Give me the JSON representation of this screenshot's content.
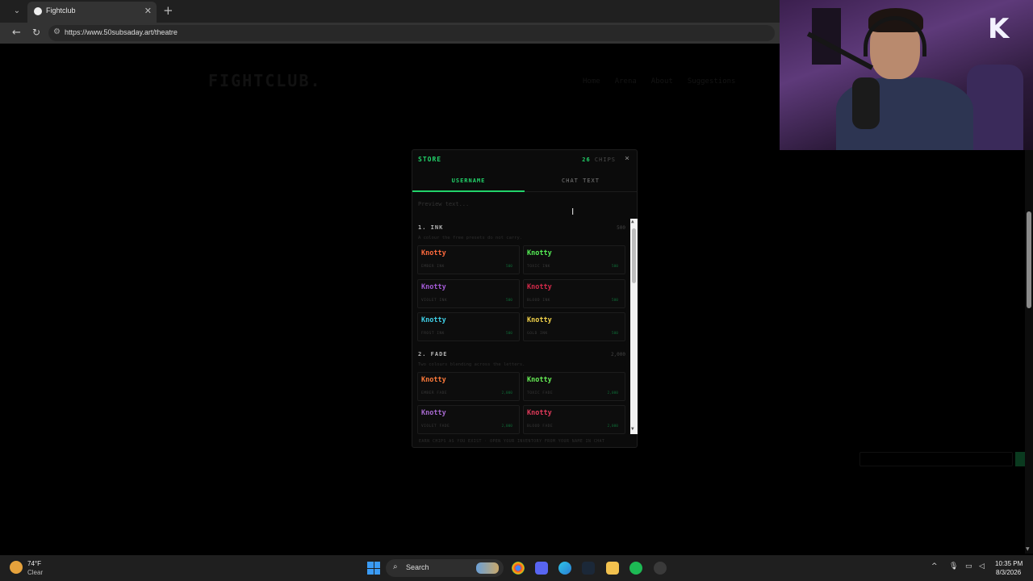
{
  "browser": {
    "tab_title": "Fightclub",
    "url": "https://www.50subsaday.art/theatre"
  },
  "site": {
    "logo": "FIGHTCLUB.",
    "nav": [
      "Home",
      "Arena",
      "About",
      "Suggestions"
    ]
  },
  "webcam": {
    "logo_letter": "K"
  },
  "store": {
    "title": "STORE",
    "chips_count": "26",
    "chips_label": "CHIPS",
    "close": "×",
    "tabs": [
      "USERNAME",
      "CHAT TEXT"
    ],
    "preview_placeholder": "Preview text...",
    "sections": [
      {
        "head": "1. INK",
        "price": "500",
        "desc": "A colour the free presets do not carry.",
        "items": [
          {
            "name": "Knotty",
            "sub": "EMBER INK",
            "price": "500",
            "color": "#ff6a3d"
          },
          {
            "name": "Knotty",
            "sub": "TOXIC INK",
            "price": "500",
            "color": "#55ee55"
          },
          {
            "name": "Knotty",
            "sub": "VIOLET INK",
            "price": "500",
            "color": "#a55bd8"
          },
          {
            "name": "Knotty",
            "sub": "BLOOD INK",
            "price": "500",
            "color": "#d42a4a"
          },
          {
            "name": "Knotty",
            "sub": "FROST INK",
            "price": "500",
            "color": "#3fd0e8"
          },
          {
            "name": "Knotty",
            "sub": "GOLD INK",
            "price": "500",
            "color": "#f2d24a"
          }
        ]
      },
      {
        "head": "2. FADE",
        "price": "2,000",
        "desc": "Two colours blending across the letters.",
        "items": [
          {
            "name": "Knotty",
            "sub": "EMBER FADE",
            "price": "2,000",
            "color": "#ff7a3a"
          },
          {
            "name": "Knotty",
            "sub": "TOXIC FADE",
            "price": "2,000",
            "color": "#66ee55"
          },
          {
            "name": "Knotty",
            "sub": "VIOLET FADE",
            "price": "2,000",
            "color": "#a86ad0"
          },
          {
            "name": "Knotty",
            "sub": "BLOOD FADE",
            "price": "2,000",
            "color": "#e03a5a"
          }
        ]
      }
    ],
    "footer": "EARN CHIPS AS YOU EXIST · OPEN YOUR INVENTORY FROM YOUR NAME IN CHAT"
  },
  "taskbar": {
    "temp": "74°F",
    "condition": "Clear",
    "search": "Search",
    "time": "10:35 PM",
    "date": "8/3/2026"
  },
  "colors": {
    "accent": "#22d36a",
    "modal_bg": "#0b0b0b"
  }
}
